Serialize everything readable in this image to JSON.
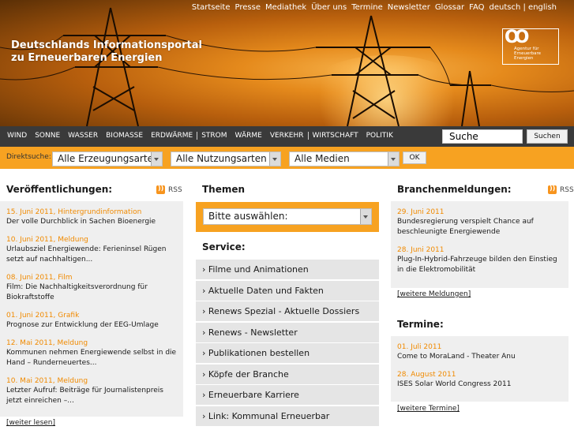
{
  "topnav": {
    "items": [
      "Startseite",
      "Presse",
      "Mediathek",
      "Über uns",
      "Termine",
      "Newsletter",
      "Glossar",
      "FAQ"
    ],
    "lang_de": "deutsch",
    "lang_sep": " | ",
    "lang_en": "english"
  },
  "header": {
    "title_line1": "Deutschlands Informationsportal",
    "title_line2": "zu Erneuerbaren Energien",
    "logo_text": "Agentur für Erneuerbare Energien"
  },
  "mainnav": {
    "items": [
      "WIND",
      "SONNE",
      "WASSER",
      "BIOMASSE",
      "ERDWÄRME",
      "STROM",
      "WÄRME",
      "VERKEHR",
      "WIRTSCHAFT",
      "POLITIK"
    ]
  },
  "search": {
    "value": "Suche",
    "button": "Suchen"
  },
  "filter": {
    "label": "Direktsuche:",
    "select1": "Alle Erzeugungsarten",
    "select2": "Alle Nutzungsarten",
    "select3": "Alle Medien",
    "ok": "OK"
  },
  "publications": {
    "heading": "Veröffentlichungen:",
    "rss": "RSS",
    "items": [
      {
        "meta": "15. Juni 2011, Hintergrundinformation",
        "title": "Der volle Durchblick in Sachen Bioenergie"
      },
      {
        "meta": "10. Juni 2011, Meldung",
        "title": "Urlaubsziel Energiewende: Ferieninsel Rügen setzt auf nachhaltigen..."
      },
      {
        "meta": "08. Juni 2011, Film",
        "title": "Film: Die Nachhaltigkeitsverordnung für Biokraftstoffe"
      },
      {
        "meta": "01. Juni 2011, Grafik",
        "title": "Prognose zur Entwicklung der EEG-Umlage"
      },
      {
        "meta": "12. Mai 2011, Meldung",
        "title": "Kommunen nehmen Energiewende selbst in die Hand – Runderneuertes..."
      },
      {
        "meta": "10. Mai 2011, Meldung",
        "title": "Letzter Aufruf: Beiträge für Journalistenpreis jetzt einreichen –..."
      }
    ],
    "more": "[weiter lesen]"
  },
  "themen": {
    "heading": "Themen",
    "select": "Bitte auswählen:"
  },
  "service": {
    "heading": "Service:",
    "items": [
      "Filme und Animationen",
      "Aktuelle Daten und Fakten",
      "Renews Spezial - Aktuelle Dossiers",
      "Renews - Newsletter",
      "Publikationen bestellen",
      "Köpfe der Branche",
      "Erneuerbare Karriere",
      "Link: Kommunal Erneuerbar"
    ]
  },
  "branchen": {
    "heading": "Branchenmeldungen:",
    "rss": "RSS",
    "items": [
      {
        "date": "29. Juni 2011",
        "title": "Bundesregierung verspielt Chance auf beschleunigte Energiewende"
      },
      {
        "date": "28. Juni 2011",
        "title": "Plug-In-Hybrid-Fahrzeuge bilden den Einstieg in die Elektromobilität"
      }
    ],
    "more": "[weitere Meldungen]"
  },
  "termine": {
    "heading": "Termine:",
    "items": [
      {
        "date": "01. Juli 2011",
        "title": "Come to MoraLand - Theater Anu"
      },
      {
        "date": "28. August 2011",
        "title": "ISES Solar World Congress 2011"
      }
    ],
    "more": "[weitere Termine]"
  }
}
